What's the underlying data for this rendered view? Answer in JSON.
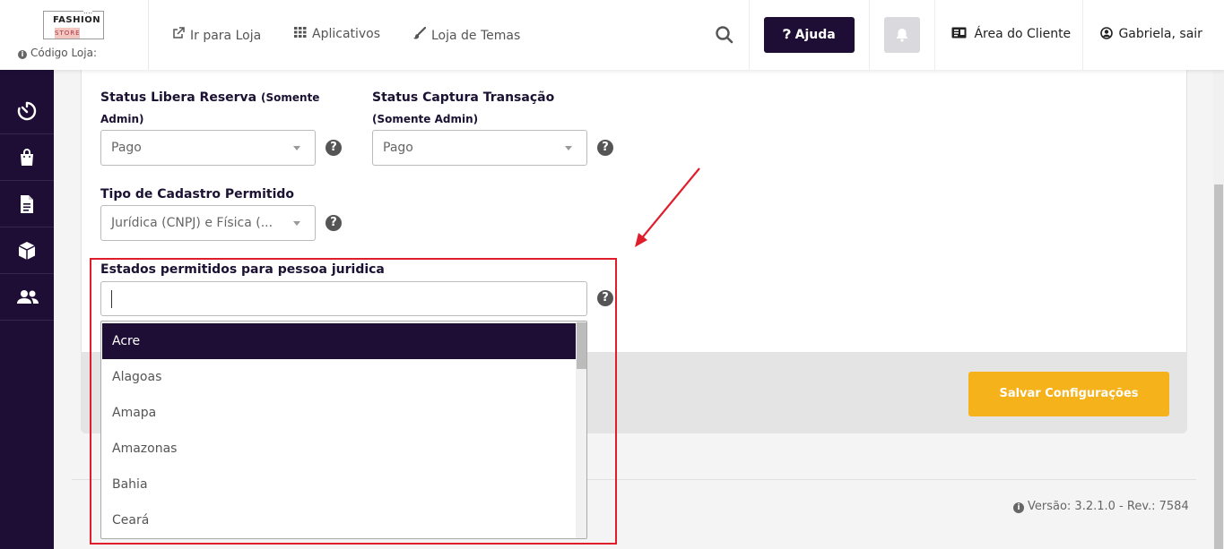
{
  "header": {
    "logo": {
      "line1": "FASHION",
      "line2": "STORE",
      "line3": "...."
    },
    "store_code_label": "Código Loja:",
    "nav": {
      "store_link": "Ir para Loja",
      "apps_link": "Aplicativos",
      "themes_link": "Loja de Temas"
    },
    "help_button": "Ajuda",
    "client_area": "Área do Cliente",
    "user_logout": "Gabriela, sair"
  },
  "form": {
    "status_reserva": {
      "label": "Status Libera Reserva",
      "label_note_1": "(Somente",
      "label_note_2": "Admin)",
      "value": "Pago"
    },
    "status_captura": {
      "label": "Status Captura Transação",
      "label_note": "(Somente Admin)",
      "value": "Pago"
    },
    "tipo_cadastro": {
      "label": "Tipo de Cadastro Permitido",
      "value": "Jurídica (CNPJ) e Física (..."
    },
    "estados": {
      "label": "Estados permitidos para pessoa juridica",
      "input_value": "",
      "options": [
        "Acre",
        "Alagoas",
        "Amapa",
        "Amazonas",
        "Bahia",
        "Ceará"
      ],
      "active_index": 0
    },
    "save_button": "Salvar Configurações"
  },
  "footer": {
    "version": "Versão: 3.2.1.0 - Rev.: 7584"
  },
  "colors": {
    "brand_dark": "#1e0e35",
    "save_button": "#f5b21b",
    "highlight": "#e01e2b"
  }
}
